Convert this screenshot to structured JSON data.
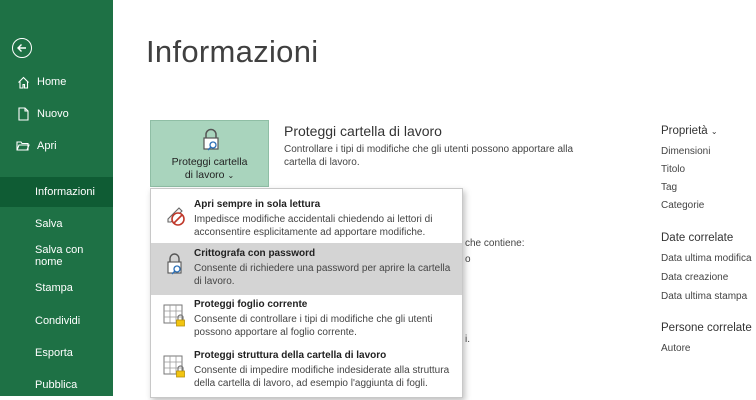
{
  "sidebar": {
    "items": [
      {
        "label": "Home",
        "icon": "home-icon"
      },
      {
        "label": "Nuovo",
        "icon": "new-document-icon"
      },
      {
        "label": "Apri",
        "icon": "open-folder-icon"
      },
      {
        "label": "Informazioni",
        "active": true
      },
      {
        "label": "Salva"
      },
      {
        "label": "Salva con nome"
      },
      {
        "label": "Stampa"
      },
      {
        "label": "Condividi"
      },
      {
        "label": "Esporta"
      },
      {
        "label": "Pubblica"
      }
    ]
  },
  "main": {
    "title": "Informazioni",
    "protect": {
      "button_label_line1": "Proteggi cartella",
      "button_label_line2": "di lavoro",
      "section_title": "Proteggi cartella di lavoro",
      "section_desc": "Controllare i tipi di modifiche che gli utenti possono apportare alla cartella di lavoro."
    },
    "behind_fragments": [
      "che contiene:",
      "o",
      "i."
    ]
  },
  "properties": {
    "header": "Proprietà",
    "items": [
      "Dimensioni",
      "Titolo",
      "Tag",
      "Categorie"
    ],
    "dates_header": "Date correlate",
    "dates": [
      "Data ultima modifica",
      "Data creazione",
      "Data ultima stampa"
    ],
    "people_header": "Persone correlate",
    "people": [
      "Autore"
    ]
  },
  "menu": {
    "items": [
      {
        "title": "Apri sempre in sola lettura",
        "desc": "Impedisce modifiche accidentali chiedendo ai lettori di acconsentire esplicitamente ad apportare modifiche.",
        "icon": "no-edit-pencil-icon"
      },
      {
        "title": "Crittografa con password",
        "desc": "Consente di richiedere una password per aprire la cartella di lavoro.",
        "icon": "lock-key-icon",
        "highlighted": true
      },
      {
        "title": "Proteggi foglio corrente",
        "desc": "Consente di controllare i tipi di modifiche che gli utenti possono apportare al foglio corrente.",
        "icon": "sheet-lock-icon"
      },
      {
        "title": "Proteggi struttura della cartella di lavoro",
        "desc": "Consente di impedire modifiche indesiderate alla struttura della cartella di lavoro, ad esempio l'aggiunta di fogli.",
        "icon": "workbook-lock-icon"
      }
    ]
  },
  "colors": {
    "sidebar": "#1e7145",
    "active": "#0f5c34",
    "button": "#a9d4bd",
    "highlight": "#d4d4d4",
    "lock": "#f2c511"
  }
}
